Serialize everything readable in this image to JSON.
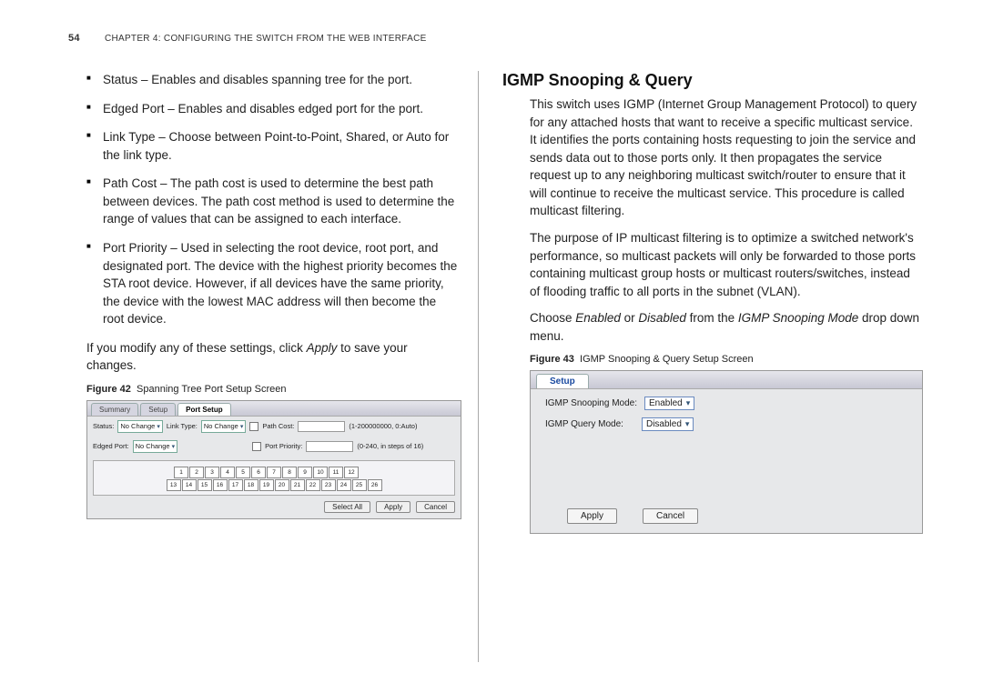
{
  "header": {
    "page_number": "54",
    "chapter_line": "CHAPTER 4: CONFIGURING THE SWITCH FROM THE WEB INTERFACE"
  },
  "left": {
    "bullets": [
      "Status – Enables and disables spanning tree for the port.",
      "Edged Port – Enables and disables edged port for the port.",
      "Link Type – Choose between Point-to-Point, Shared, or Auto for the link type.",
      "Path Cost – The path cost is used to determine the best path between devices. The path cost method is used to determine the range of values that can be assigned to each interface.",
      "Port Priority – Used in selecting the root device, root port, and designated port. The device with the highest priority becomes the STA root device. However, if all devices have the same priority, the device with the lowest MAC address will then become the root device."
    ],
    "apply_line_pre": "If you modify any of these settings, click ",
    "apply_word": "Apply",
    "apply_line_post": " to save your changes.",
    "fig_label_bold": "Figure 42",
    "fig_label_text": "Spanning Tree Port Setup Screen",
    "fig42": {
      "tabs": [
        "Summary",
        "Setup",
        "Port Setup"
      ],
      "active_tab": "Port Setup",
      "status_label": "Status:",
      "status_value": "No Change",
      "linktype_label": "Link Type:",
      "linktype_value": "No Change",
      "pathcost_label": "Path Cost:",
      "pathcost_hint": "(1-200000000, 0:Auto)",
      "edged_label": "Edged Port:",
      "edged_value": "No Change",
      "portpriority_label": "Port Priority:",
      "portpriority_hint": "(0-240, in steps of 16)",
      "ports_row1": [
        "1",
        "2",
        "3",
        "4",
        "5",
        "6",
        "7",
        "8",
        "9",
        "10",
        "11",
        "12"
      ],
      "ports_row2": [
        "13",
        "14",
        "15",
        "16",
        "17",
        "18",
        "19",
        "20",
        "21",
        "22",
        "23",
        "24",
        "25",
        "26"
      ],
      "buttons": {
        "selectall": "Select All",
        "apply": "Apply",
        "cancel": "Cancel"
      }
    }
  },
  "right": {
    "heading": "IGMP Snooping & Query",
    "p1": "This switch uses IGMP (Internet Group Management Protocol) to query for any attached hosts that want to receive a specific multicast service. It identifies the ports containing hosts requesting to join the service and sends data out to those ports only. It then propagates the service request up to any neighboring multicast switch/router to ensure that it will continue to receive the multicast service. This procedure is called multicast filtering.",
    "p2": "The purpose of IP multicast filtering is to optimize a switched network's performance, so multicast packets will only be forwarded to those ports containing multicast group hosts or multicast routers/switches, instead of flooding traffic to all ports in the subnet (VLAN).",
    "p3_pre": "Choose ",
    "p3_en": "Enabled",
    "p3_mid1": " or ",
    "p3_dis": "Disabled",
    "p3_mid2": " from the ",
    "p3_mode": "IGMP Snooping Mode",
    "p3_post": " drop down menu.",
    "fig_label_bold": "Figure 43",
    "fig_label_text": "IGMP Snooping & Query Setup Screen",
    "fig43": {
      "tab": "Setup",
      "snoop_label": "IGMP Snooping Mode:",
      "snoop_value": "Enabled",
      "query_label": "IGMP Query Mode:",
      "query_value": "Disabled",
      "apply": "Apply",
      "cancel": "Cancel"
    }
  }
}
